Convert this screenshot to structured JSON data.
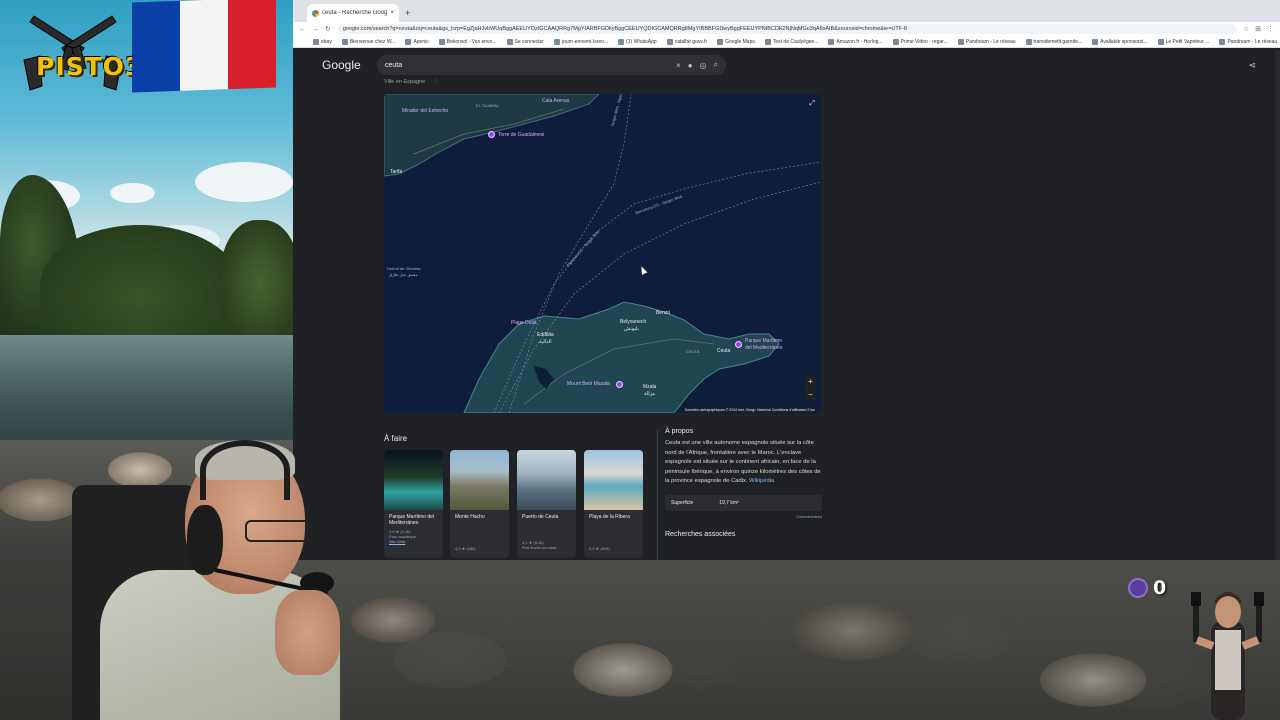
{
  "overlay": {
    "logo_text": "PISTO37",
    "flag_colors": [
      "#0b3fa8",
      "#f4f4f4",
      "#d8202c"
    ],
    "counter_value": "0"
  },
  "browser": {
    "tab_title": "ceuta - Recherche Google",
    "new_tab": "+",
    "url": "google.com/search?q=ceuta&oq=ceuta&gs_lcrp=EgZjaHJvbWUqBggAEEUYOzIGCAAQRRg7MgYIARBFGDkyBggCEEUYQDIGCAMQRRg8MgYIBBBFGDwyBggFEEUYPNIBCDE2NjNqMGo3qAIIsAIB&sourceid=chrome&ie=UTF-8",
    "bookmarks": [
      "ebay",
      "Bienvenue chez W...",
      "Apenic",
      "Bekonsol - Vos envo...",
      "Se connecter",
      "journ-ennemi-Isreo...",
      "(1) WhatsApp",
      "catalhé.gouv.fr",
      "Google Maps",
      "Test de Caulyègee...",
      "Amazon.fr - Horlog...",
      "Prime Video - regar...",
      "Pandream - Le réseau",
      "transdemetit.garnde...",
      "Available sponsorst...",
      "Le Petit Vapoteur ...",
      "Pandream - Le réseau"
    ]
  },
  "google": {
    "logo": "Google",
    "query": "ceuta",
    "subtitle": "Ville en Espagne",
    "subtitle_more": "⋮"
  },
  "map": {
    "labels": {
      "tarifa": "Tarifa",
      "benzu": "Benzú",
      "belyounech": "Belyounech",
      "belyounech_ar": "بليونش",
      "ceuta": "Ceuta",
      "ceuta_caps": "CEUTA",
      "eddalia": "Eddâlia",
      "eddalia_ar": "الدالية",
      "mzala": "Mzala",
      "mzala_ar": "مزالة",
      "gibraltar": "Detroit de Gibraltar",
      "gibraltar_ar": "مضيق جبل طارق",
      "playa_dalia": "Plage Dalia",
      "parque_mar": "Parque Marítimo",
      "parque_mar2": "del Mediterráneo",
      "mount": "Mount Beni Mazala",
      "torre": "Torre de Guadalmesi",
      "mirador": "Mirador del Estrecho",
      "cala": "Cala Arenas",
      "ferry1": "Tanger Med - Algeciras",
      "ferry2": "Barcelona-ES - Tanger Med",
      "ferry3": "Algeciras ES - Tanger Med"
    },
    "attribution": "Données cartographiques © 2024 Inst. Geogr. Nacional   Conditions d'utilisation   2 km",
    "zoom_in": "+",
    "zoom_out": "−",
    "expand": "⤢"
  },
  "afaire": {
    "title": "À faire",
    "cards": [
      {
        "name": "Parque Marítimo del Mediterráneo",
        "rating": "4,6 ★ (2,1k)",
        "type": "Parc aquatique",
        "link": "Site Web"
      },
      {
        "name": "Monte Hacho",
        "rating": "4,3 ★ (188)",
        "type": "",
        "link": ""
      },
      {
        "name": "Puerto de Ceuta",
        "rating": "4,1 ★ (5,2k)",
        "type": "Port fluvial ou marit.",
        "link": ""
      },
      {
        "name": "Playa de la Ribera",
        "rating": "4,2 ★ (549)",
        "type": "",
        "link": ""
      }
    ]
  },
  "apropos": {
    "title": "À propos",
    "text": "Ceuta est une ville autonome espagnole située sur la côte nord de l'Afrique, frontalière avec le Maroc. L'enclave espagnole est située sur le continent africain, en face de la péninsule Ibérique, à environ quinze kilomètres des côtes de la province espagnole de Cadix. ",
    "wiki": "Wikipédia",
    "superficie_label": "Superficie",
    "superficie_value": "19,7 km²",
    "comments": "Commentaires",
    "related": "Recherches associées"
  }
}
